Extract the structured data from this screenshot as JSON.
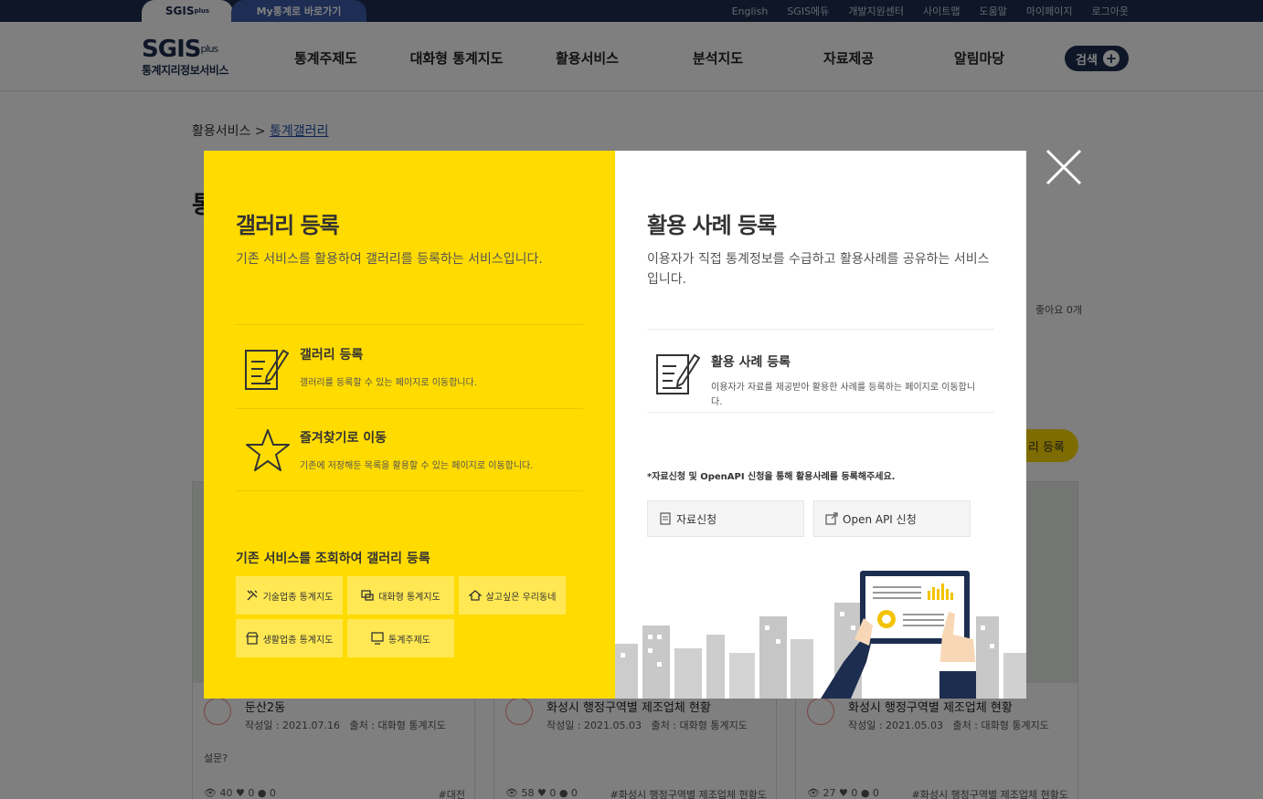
{
  "topbar": {
    "tab_sgis": "SGIS",
    "tab_sgis_sup": "plus",
    "tab_my": "My통계로 바로가기",
    "links": [
      "English",
      "SGIS에듀",
      "개발지원센터",
      "사이트맵",
      "도움말",
      "마이페이지",
      "로그아웃"
    ]
  },
  "header": {
    "logo_main": "SGIS",
    "logo_sup": "plus",
    "logo_sub": "통계지리정보서비스",
    "nav": [
      "통계주제도",
      "대화형 통계지도",
      "활용서비스",
      "분석지도",
      "자료제공",
      "알림마당"
    ],
    "search_label": "검색"
  },
  "page": {
    "breadcrumb_parent": "활용서비스",
    "breadcrumb_current": "통계갤러리",
    "title_partial": "통",
    "likes": "좋아요 0개",
    "register_btn": "리 등록",
    "cards": [
      {
        "title": "둔산2동",
        "date": "작성일 : 2021.07.16",
        "source": "출처 : 대화형 통계지도",
        "question": "설문?",
        "views": "40",
        "hearts": "0",
        "comments": "0",
        "tag": "#대전"
      },
      {
        "title": "화성시 행정구역별 제조업체 현황",
        "date": "작성일 : 2021.05.03",
        "source": "출처 : 대화형 통계지도",
        "question": "",
        "views": "58",
        "hearts": "0",
        "comments": "0",
        "tag": "#화성시 행정구역별 제조업체 현황도"
      },
      {
        "title": "화성시 행정구역별 제조업체 현황",
        "date": "작성일 : 2021.05.03",
        "source": "출처 : 대화형 통계지도",
        "question": "",
        "views": "27",
        "hearts": "0",
        "comments": "0",
        "tag": "#화성시 행정구역별 제조업체 현황도"
      }
    ]
  },
  "modal": {
    "left": {
      "title": "갤러리 등록",
      "desc": "기존 서비스를 활용하여 갤러리를 등록하는 서비스입니다.",
      "items": [
        {
          "title": "갤러리 등록",
          "desc": "갤러리를 등록할 수 있는 페이지로 이동합니다."
        },
        {
          "title": "즐겨찾기로 이동",
          "desc": "기존에 저장해둔 목록을 활용할 수 있는 페이지로 이동합니다."
        }
      ],
      "sub_title": "기존 서비스를 조회하여 갤러리 등록",
      "services": [
        "기술업종 통계지도",
        "대화형 통계지도",
        "살고싶은 우리동네",
        "생활업종 통계지도",
        "통계주제도"
      ]
    },
    "right": {
      "title": "활용 사례 등록",
      "desc": "이용자가 직접 통계정보를 수급하고 활용사례를 공유하는 서비스입니다.",
      "item_title": "활용 사례 등록",
      "item_desc": "이용자가 자료를 제공받아 활용한 사례를 등록하는 페이지로 이동합니다.",
      "note": "*자료신청 및 OpenAPI 신청을 통해 활용사례를 등록해주세요.",
      "btn_data": "자료신청",
      "btn_api": "Open API 신청"
    }
  }
}
